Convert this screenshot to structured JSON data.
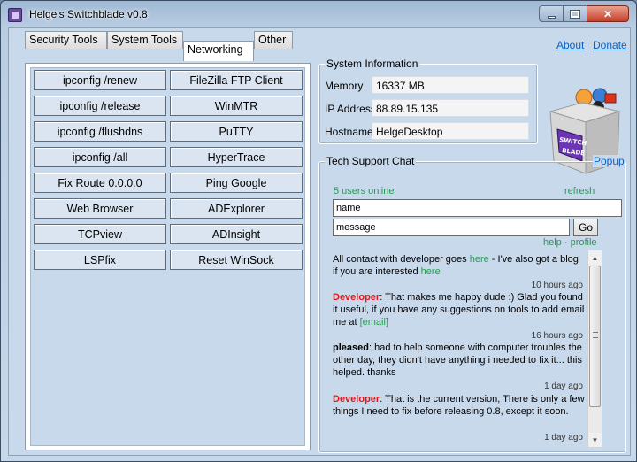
{
  "window": {
    "title": "Helge's Switchblade v0.8"
  },
  "tabs": [
    {
      "label": "Security Tools",
      "active": false
    },
    {
      "label": "System Tools",
      "active": false
    },
    {
      "label": "Networking",
      "active": true
    },
    {
      "label": "Other",
      "active": false
    }
  ],
  "tools": [
    "ipconfig /renew",
    "FileZilla FTP Client",
    "ipconfig /release",
    "WinMTR",
    "ipconfig /flushdns",
    "PuTTY",
    "ipconfig /all",
    "HyperTrace",
    "Fix Route 0.0.0.0",
    "Ping Google",
    "Web Browser",
    "ADExplorer",
    "TCPview",
    "ADInsight",
    "LSPfix",
    "Reset WinSock"
  ],
  "header_links": {
    "about": "About",
    "donate": "Donate"
  },
  "system_info": {
    "title": "System Information",
    "memory_label": "Memory",
    "memory_value": "16337 MB",
    "ip_label": "IP Address",
    "ip_value": "88.89.15.135",
    "hostname_label": "Hostname",
    "hostname_value": "HelgeDesktop"
  },
  "logo": {
    "text_line1": "SWITCH",
    "text_line2": "BLADE"
  },
  "chat": {
    "title": "Tech Support Chat",
    "popup_label": "Popup",
    "users_online": "5 users online",
    "refresh_label": "refresh",
    "name_value": "name",
    "message_value": "message",
    "go_label": "Go",
    "help_label": "help",
    "separator": "·",
    "profile_label": "profile",
    "intro_1": "All contact with developer goes ",
    "intro_here1": "here",
    "intro_2": " - I've also got a blog if you are interested ",
    "intro_here2": "here",
    "messages": [
      {
        "time": "10 hours ago",
        "author": "Developer",
        "text": ": That makes me happy dude :) Glad you found it useful, if you have any suggestions on tools to add email me at ",
        "link": "[email]"
      },
      {
        "time": "16 hours ago",
        "author": "pleased",
        "text": ": had to help someone with computer troubles the other day, they didn't have anything i needed to fix it... this helped. thanks"
      },
      {
        "time": "1 day ago",
        "author": "Developer",
        "text": ": That is the current version, There is only a few things I need to fix before releasing 0.8, except it soon."
      },
      {
        "time": "1 day ago"
      }
    ]
  },
  "colors": {
    "client_bg": "#c8d9ec",
    "link": "#0b62c4",
    "chat_green": "#279b52",
    "developer_red": "#e2191b"
  }
}
